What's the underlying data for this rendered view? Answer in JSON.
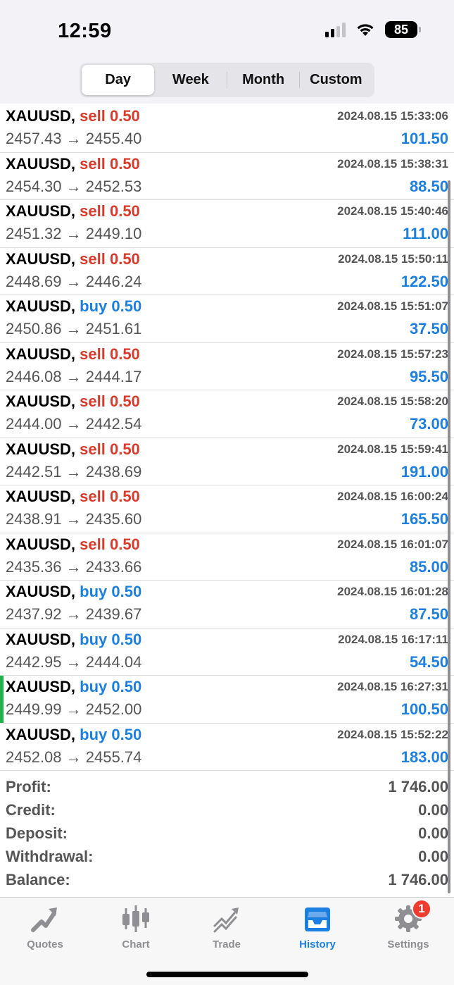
{
  "status_bar": {
    "time": "12:59",
    "battery": "85"
  },
  "period_tabs": [
    {
      "label": "Day",
      "active": true
    },
    {
      "label": "Week",
      "active": false
    },
    {
      "label": "Month",
      "active": false
    },
    {
      "label": "Custom",
      "active": false
    }
  ],
  "deals": [
    {
      "symbol": "XAUUSD,",
      "direction": "sell",
      "lot": "0.50",
      "time": "2024.08.15 15:33:06",
      "open": "2457.43",
      "close": "2455.40",
      "profit": "101.50"
    },
    {
      "symbol": "XAUUSD,",
      "direction": "sell",
      "lot": "0.50",
      "time": "2024.08.15 15:38:31",
      "open": "2454.30",
      "close": "2452.53",
      "profit": "88.50"
    },
    {
      "symbol": "XAUUSD,",
      "direction": "sell",
      "lot": "0.50",
      "time": "2024.08.15 15:40:46",
      "open": "2451.32",
      "close": "2449.10",
      "profit": "111.00"
    },
    {
      "symbol": "XAUUSD,",
      "direction": "sell",
      "lot": "0.50",
      "time": "2024.08.15 15:50:11",
      "open": "2448.69",
      "close": "2446.24",
      "profit": "122.50"
    },
    {
      "symbol": "XAUUSD,",
      "direction": "buy",
      "lot": "0.50",
      "time": "2024.08.15 15:51:07",
      "open": "2450.86",
      "close": "2451.61",
      "profit": "37.50"
    },
    {
      "symbol": "XAUUSD,",
      "direction": "sell",
      "lot": "0.50",
      "time": "2024.08.15 15:57:23",
      "open": "2446.08",
      "close": "2444.17",
      "profit": "95.50"
    },
    {
      "symbol": "XAUUSD,",
      "direction": "sell",
      "lot": "0.50",
      "time": "2024.08.15 15:58:20",
      "open": "2444.00",
      "close": "2442.54",
      "profit": "73.00"
    },
    {
      "symbol": "XAUUSD,",
      "direction": "sell",
      "lot": "0.50",
      "time": "2024.08.15 15:59:41",
      "open": "2442.51",
      "close": "2438.69",
      "profit": "191.00"
    },
    {
      "symbol": "XAUUSD,",
      "direction": "sell",
      "lot": "0.50",
      "time": "2024.08.15 16:00:24",
      "open": "2438.91",
      "close": "2435.60",
      "profit": "165.50"
    },
    {
      "symbol": "XAUUSD,",
      "direction": "sell",
      "lot": "0.50",
      "time": "2024.08.15 16:01:07",
      "open": "2435.36",
      "close": "2433.66",
      "profit": "85.00"
    },
    {
      "symbol": "XAUUSD,",
      "direction": "buy",
      "lot": "0.50",
      "time": "2024.08.15 16:01:28",
      "open": "2437.92",
      "close": "2439.67",
      "profit": "87.50"
    },
    {
      "symbol": "XAUUSD,",
      "direction": "buy",
      "lot": "0.50",
      "time": "2024.08.15 16:17:11",
      "open": "2442.95",
      "close": "2444.04",
      "profit": "54.50"
    },
    {
      "symbol": "XAUUSD,",
      "direction": "buy",
      "lot": "0.50",
      "time": "2024.08.15 16:27:31",
      "open": "2449.99",
      "close": "2452.00",
      "profit": "100.50",
      "selected": true
    },
    {
      "symbol": "XAUUSD,",
      "direction": "buy",
      "lot": "0.50",
      "time": "2024.08.15 15:52:22",
      "open": "2452.08",
      "close": "2455.74",
      "profit": "183.00"
    }
  ],
  "arrow": "→",
  "summary": [
    {
      "label": "Profit:",
      "value": "1 746.00"
    },
    {
      "label": "Credit:",
      "value": "0.00"
    },
    {
      "label": "Deposit:",
      "value": "0.00"
    },
    {
      "label": "Withdrawal:",
      "value": "0.00"
    },
    {
      "label": "Balance:",
      "value": "1 746.00"
    }
  ],
  "tabbar": {
    "items": [
      {
        "label": "Quotes",
        "icon": "quotes-icon",
        "active": false
      },
      {
        "label": "Chart",
        "icon": "chart-icon",
        "active": false
      },
      {
        "label": "Trade",
        "icon": "trade-icon",
        "active": false
      },
      {
        "label": "History",
        "icon": "history-icon",
        "active": true
      },
      {
        "label": "Settings",
        "icon": "gear-icon",
        "active": false,
        "badge": "1"
      }
    ]
  },
  "colors": {
    "sell": "#d93a2b",
    "buy": "#1c7fe2",
    "profit": "#1c7fe2",
    "selected_marker": "#1fb34a"
  }
}
